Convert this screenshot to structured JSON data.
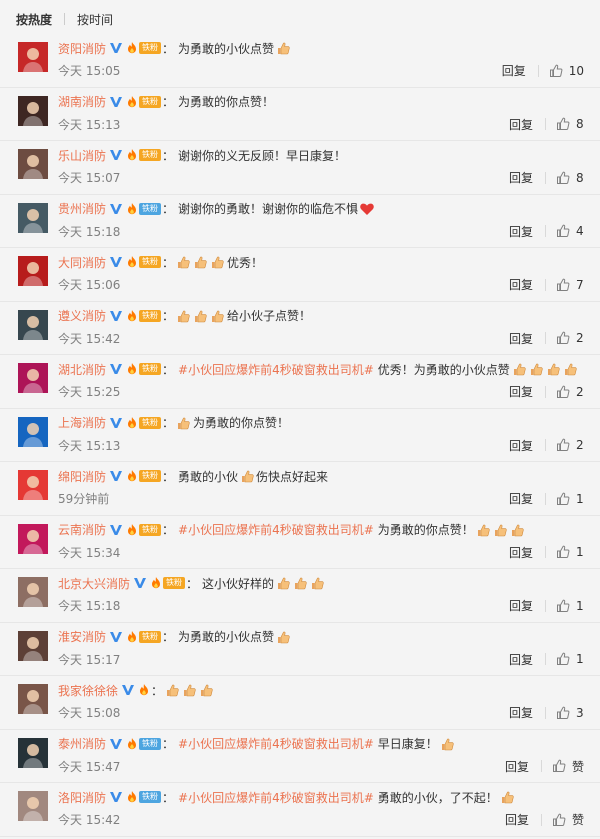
{
  "tabs": {
    "hot": "按热度",
    "time": "按时间"
  },
  "colors": {
    "name": "#eb7350",
    "topic": "#eb7350",
    "fan_gold": "#f5a623",
    "fan_iron": "#4da5e0"
  },
  "comments": [
    {
      "user": "资阳消防",
      "fan": "铁粉",
      "fan_type": "gold",
      "text": "为勇敢的小伙点赞",
      "emojis_after": 1,
      "time": "今天 15:05",
      "reply": "回复",
      "likes": "10"
    },
    {
      "user": "湖南消防",
      "fan": "铁粉",
      "fan_type": "gold",
      "text": "为勇敢的你点赞！",
      "emojis_after": 0,
      "time": "今天 15:13",
      "reply": "回复",
      "likes": "8"
    },
    {
      "user": "乐山消防",
      "fan": "铁粉",
      "fan_type": "gold",
      "text": "谢谢你的义无反顾！早日康复！",
      "emojis_after": 0,
      "time": "今天 15:07",
      "reply": "回复",
      "likes": "8"
    },
    {
      "user": "贵州消防",
      "fan": "铁粉",
      "fan_type": "iron",
      "text": "谢谢你的勇敢！谢谢你的临危不惧",
      "heart": true,
      "time": "今天 15:18",
      "reply": "回复",
      "likes": "4"
    },
    {
      "user": "大同消防",
      "fan": "铁粉",
      "fan_type": "gold",
      "emojis_before": 3,
      "text": "优秀！",
      "time": "今天 15:06",
      "reply": "回复",
      "likes": "7"
    },
    {
      "user": "遵义消防",
      "fan": "铁粉",
      "fan_type": "gold",
      "emojis_before": 3,
      "text": "给小伙子点赞！",
      "time": "今天 15:42",
      "reply": "回复",
      "likes": "2"
    },
    {
      "user": "湖北消防",
      "fan": "铁粉",
      "fan_type": "gold",
      "topic": "#小伙回应爆炸前4秒破窗救出司机#",
      "text": "优秀！为勇敢的小伙点赞",
      "emojis_after": 4,
      "time": "今天 15:25",
      "reply": "回复",
      "likes": "2"
    },
    {
      "user": "上海消防",
      "fan": "铁粉",
      "fan_type": "gold",
      "emojis_before": 1,
      "text": "为勇敢的你点赞！",
      "time": "今天 15:13",
      "reply": "回复",
      "likes": "2"
    },
    {
      "user": "绵阳消防",
      "fan": "铁粉",
      "fan_type": "gold",
      "text": "勇敢的小伙",
      "emojis_after": 1,
      "text2": "伤快点好起来",
      "time": "59分钟前",
      "reply": "回复",
      "likes": "1"
    },
    {
      "user": "云南消防",
      "fan": "铁粉",
      "fan_type": "gold",
      "topic": "#小伙回应爆炸前4秒破窗救出司机#",
      "text": "为勇敢的你点赞！",
      "emojis_after": 3,
      "time": "今天 15:34",
      "reply": "回复",
      "likes": "1"
    },
    {
      "user": "北京大兴消防",
      "fan": "铁粉",
      "fan_type": "gold",
      "text": "这小伙好样的",
      "emojis_after": 3,
      "time": "今天 15:18",
      "reply": "回复",
      "likes": "1"
    },
    {
      "user": "淮安消防",
      "fan": "铁粉",
      "fan_type": "gold",
      "text": "为勇敢的小伙点赞",
      "emojis_after": 1,
      "time": "今天 15:17",
      "reply": "回复",
      "likes": "1"
    },
    {
      "user": "我家徐徐徐",
      "fan": "",
      "fan_type": "none",
      "emojis_before": 3,
      "text": "",
      "time": "今天 15:08",
      "reply": "回复",
      "likes": "3"
    },
    {
      "user": "泰州消防",
      "fan": "铁粉",
      "fan_type": "iron",
      "topic": "#小伙回应爆炸前4秒破窗救出司机#",
      "text": "早日康复！",
      "emojis_after": 1,
      "time": "今天 15:47",
      "reply": "回复",
      "likes": "赞"
    },
    {
      "user": "洛阳消防",
      "fan": "铁粉",
      "fan_type": "iron",
      "topic": "#小伙回应爆炸前4秒破窗救出司机#",
      "text": "勇敢的小伙，了不起！",
      "emojis_after": 1,
      "time": "今天 15:42",
      "reply": "回复",
      "likes": "赞"
    }
  ]
}
